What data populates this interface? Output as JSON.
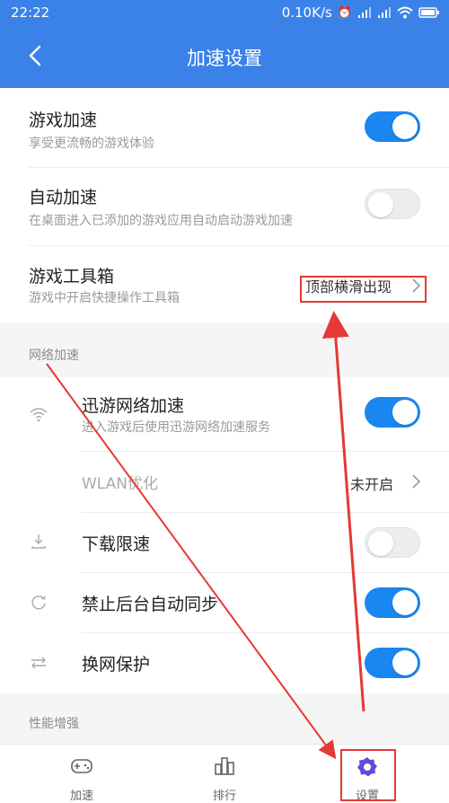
{
  "status": {
    "time": "22:22",
    "speed": "0.10K/s"
  },
  "header": {
    "title": "加速设置"
  },
  "general": [
    {
      "title": "游戏加速",
      "desc": "享受更流畅的游戏体验",
      "toggle": true
    },
    {
      "title": "自动加速",
      "desc": "在桌面进入已添加的游戏应用自动启动游戏加速",
      "toggle": false
    },
    {
      "title": "游戏工具箱",
      "desc": "游戏中开启快捷操作工具箱",
      "value": "顶部横滑出现"
    }
  ],
  "network": {
    "section": "网络加速",
    "items": [
      {
        "icon": "wifi-icon",
        "title": "迅游网络加速",
        "desc": "进入游戏后使用迅游网络加速服务",
        "toggle": true
      },
      {
        "title": "WLAN优化",
        "value": "未开启"
      },
      {
        "icon": "download-icon",
        "title": "下载限速",
        "toggle": false
      },
      {
        "icon": "sync-icon",
        "title": "禁止后台自动同步",
        "toggle": true
      },
      {
        "icon": "switch-arrows-icon",
        "title": "换网保护",
        "toggle": true
      }
    ]
  },
  "performance": {
    "section": "性能增强"
  },
  "tabs": [
    {
      "label": "加速",
      "icon": "gamepad-icon"
    },
    {
      "label": "排行",
      "icon": "chart-icon"
    },
    {
      "label": "设置",
      "icon": "settings-icon",
      "active": true
    }
  ],
  "colors": {
    "accent": "#1a86f0",
    "header": "#3b82e8",
    "annotation": "#e53935"
  }
}
